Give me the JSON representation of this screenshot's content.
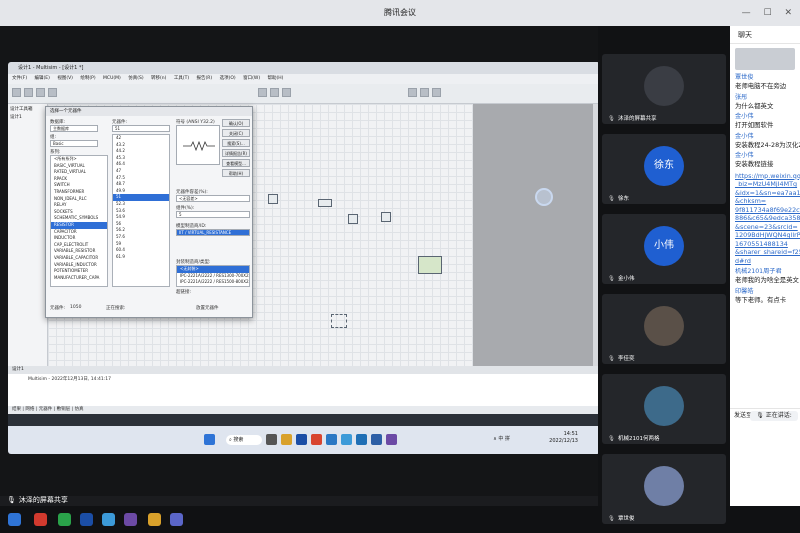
{
  "window": {
    "title": "腾讯会议",
    "controls": [
      "—",
      "☐",
      "✕"
    ]
  },
  "multisim": {
    "title": "设计1 - Multisim - [设计1 *]",
    "menu": [
      "文件(F)",
      "编辑(E)",
      "视图(V)",
      "绘制(P)",
      "MCU(M)",
      "仿真(S)",
      "转移(n)",
      "工具(T)",
      "报告(R)",
      "选项(O)",
      "窗口(W)",
      "帮助(H)"
    ],
    "left_panel": {
      "title": "设计工具箱",
      "items": [
        "设计1"
      ]
    },
    "dialog": {
      "title": "选择一个元器件",
      "db_label": "数据库:",
      "db_value": "主数据库",
      "group_label": "组:",
      "group_value": "Basic",
      "family_label": "系列:",
      "families": [
        "<所有系列>",
        "BASIC_VIRTUAL",
        "RATED_VIRTUAL",
        "RPACK",
        "SWITCH",
        "TRANSFORMER",
        "NON_IDEAL_RLC",
        "RELAY",
        "SOCKETS",
        "SCHEMATIC_SYMBOLS",
        "RESISTOR",
        "CAPACITOR",
        "INDUCTOR",
        "CAP_ELECTROLIT",
        "VARIABLE_RESISTOR",
        "VARIABLE_CAPACITOR",
        "VARIABLE_INDUCTOR",
        "POTENTIOMETER",
        "MANUFACTURER_CAPA"
      ],
      "selected_family": "RESISTOR",
      "component_label": "元器件:",
      "component_value": "51",
      "components": [
        "42",
        "43.2",
        "44.2",
        "45.3",
        "46.4",
        "47",
        "47.5",
        "48.7",
        "49.9",
        "51",
        "52.3",
        "53.6",
        "54.9",
        "56",
        "56.2",
        "57.6",
        "59",
        "60.4",
        "61.9"
      ],
      "selected_component": "51",
      "symbol_label": "符号 (ANSI Y32.2)",
      "buttons": [
        "确认(O)",
        "关闭(C)",
        "搜索(S)...",
        "详情报告(R)",
        "查看模型...",
        "帮助(H)"
      ],
      "tolerance_label": "元器件容差(%):",
      "tolerance_value": "<无容差>",
      "type_label": "组件(%):",
      "type_value": "5",
      "model_label": "模型制造商/ID:",
      "model_value": "IIT / VIRTUAL_RESISTANCE",
      "footprint_label": "封装制造商/类型:",
      "footprints": [
        "<无封装>",
        "IPC-2221A/2222 / RES1300-700X250",
        "IPC-2221A/2222 / RES1500-800X250"
      ],
      "hyperlink_label": "超链接:",
      "count_label": "元器件:",
      "count_value": "1050",
      "searching_label": "正在搜索:",
      "status_text": "放置元器件"
    },
    "bottom_tab": "设计1",
    "output_text": "Multisim - 2022年12月13日, 14:41:17",
    "status_tabs": [
      "结果",
      "网络",
      "元器件",
      "敷铜层",
      "仿真"
    ],
    "taskbar": {
      "search_label": "搜索",
      "time": "14:51",
      "date": "2022/12/13",
      "tray": [
        "∧",
        "中",
        "拼"
      ]
    }
  },
  "share_label": {
    "name": "沐泽的屏幕共享"
  },
  "participants": [
    {
      "name": "沐泽的屏幕共享",
      "avatar_text": "",
      "color": "#3a3d44",
      "mic_icon": "mic-icon"
    },
    {
      "name": "徐东",
      "avatar_text": "徐东",
      "color": "#1f5fd1",
      "mic_icon": "mic-icon"
    },
    {
      "name": "金小伟",
      "avatar_text": "小伟",
      "color": "#1f5fd1",
      "mic_icon": "mic-icon"
    },
    {
      "name": "李佳奕",
      "avatar_text": "",
      "color": "#5a5048",
      "mic_icon": "mic-icon"
    },
    {
      "name": "机械2101何两格",
      "avatar_text": "",
      "color": "#3d6a8a",
      "mic_icon": "mic-icon"
    },
    {
      "name": "覃世俊",
      "avatar_text": "",
      "color": "#6f7fa6",
      "mic_icon": "mic-icon"
    }
  ],
  "chat": {
    "title": "聊天",
    "messages": [
      {
        "name": "覃世俊",
        "text": "老师电脑不在旁边"
      },
      {
        "name": "张彤",
        "text": "为什么都英文"
      },
      {
        "name": "金小伟",
        "text": "打开如图软件"
      },
      {
        "name": "金小伟",
        "text": "安装教程24-28为汉化2"
      },
      {
        "name": "金小伟",
        "text": "安装教程链接"
      }
    ],
    "link_lines": [
      "https://mp.weixin.qq.c",
      "_biz=MzU4MjI4MTg",
      "&idx=1&sn=ea7aa14",
      "&chksm=",
      "9f811734a8f69e22cf2f",
      "886&c65&9edca358cf7",
      "&scene=23&srcid=",
      "1209BdHjWQN4gllrPQa",
      "1670551488134",
      "&sharer_shareid=f251f",
      "d#rd"
    ],
    "after": [
      {
        "name": "机械2101周子君",
        "text": "老师我的为啥全是英文"
      },
      {
        "name": "印馨皓",
        "text": "等下老师。有点卡"
      }
    ],
    "input_placeholder": "发送至",
    "talk_label": "正在讲话:"
  }
}
